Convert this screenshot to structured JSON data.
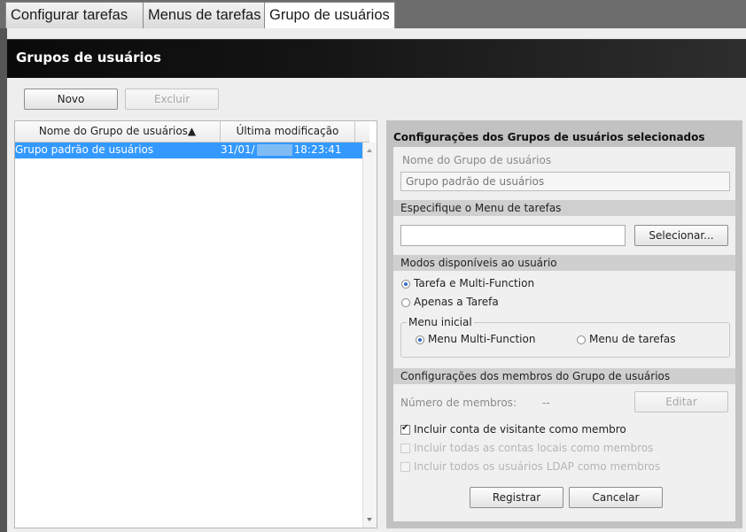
{
  "tabs": [
    {
      "label": "Configurar tarefas",
      "active": false
    },
    {
      "label": "Menus de tarefas",
      "active": false
    },
    {
      "label": "Grupo de usuários",
      "active": true
    }
  ],
  "page": {
    "title": "Grupos de usuários"
  },
  "toolbar": {
    "new_label": "Novo",
    "delete_label": "Excluir"
  },
  "list": {
    "columns": [
      "Nome do Grupo de usuários▲",
      "Última modificação"
    ],
    "rows": [
      {
        "name": "Grupo padrão de usuários",
        "date_prefix": "31/01/",
        "time": "18:23:41",
        "selected": true
      }
    ]
  },
  "details": {
    "title": "Configurações dos Grupos de usuários selecionados",
    "group_name_label": "Nome do Grupo de usuários",
    "group_name_value": "Grupo padrão de usuários",
    "task_menu_section": "Especifique o Menu de tarefas",
    "task_menu_value": "",
    "select_button": "Selecionar...",
    "modes_section": "Modos disponíveis ao usuário",
    "mode_options": [
      {
        "label": "Tarefa e Multi-Function",
        "checked": true
      },
      {
        "label": "Apenas a Tarefa",
        "checked": false
      }
    ],
    "initial_menu": {
      "legend": "Menu inicial",
      "options": [
        {
          "label": "Menu Multi-Function",
          "checked": true
        },
        {
          "label": "Menu de tarefas",
          "checked": false
        }
      ]
    },
    "members_section": "Configurações dos membros do Grupo de usuários",
    "member_count_label": "Número de membros:",
    "member_count_value": "--",
    "edit_button": "Editar",
    "checkboxes": [
      {
        "label": "Incluir conta de visitante como membro",
        "checked": true,
        "enabled": true
      },
      {
        "label": "Incluir todas as contas locais como membros",
        "checked": false,
        "enabled": false
      },
      {
        "label": "Incluir todos os usuários LDAP como membros",
        "checked": false,
        "enabled": false
      }
    ],
    "register_button": "Registrar",
    "cancel_button": "Cancelar"
  }
}
